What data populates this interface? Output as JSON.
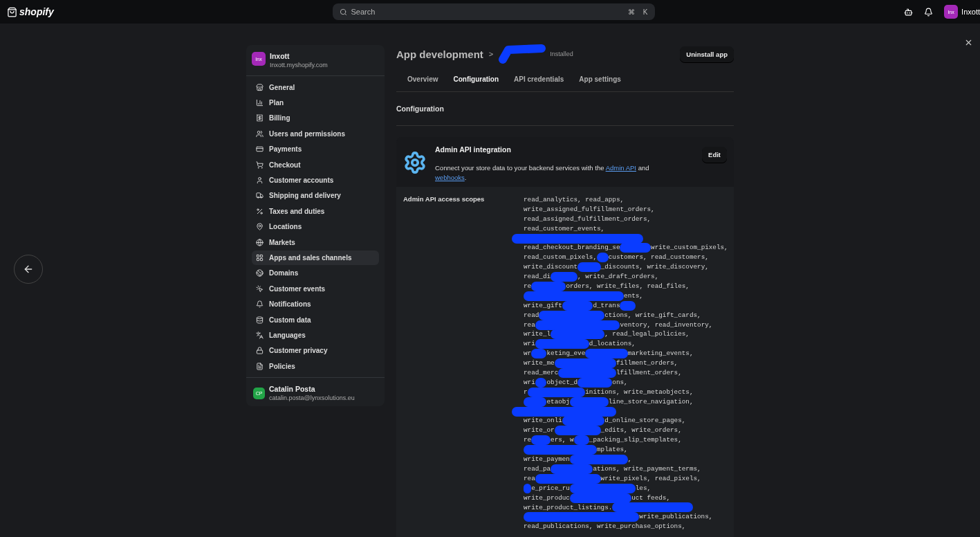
{
  "top_bar": {
    "logo": "shopify",
    "search": {
      "placeholder": "Search",
      "shortcut": [
        "⌘",
        "K"
      ]
    },
    "store_badge": "Inx",
    "store_name": "Inxott"
  },
  "sidebar": {
    "store": {
      "badge": "Inx",
      "name": "Inxott",
      "domain": "Inxott.myshopify.com"
    },
    "items": [
      {
        "label": "General",
        "selected": false
      },
      {
        "label": "Plan",
        "selected": false
      },
      {
        "label": "Billing",
        "selected": false
      },
      {
        "label": "Users and permissions",
        "selected": false
      },
      {
        "label": "Payments",
        "selected": false
      },
      {
        "label": "Checkout",
        "selected": false
      },
      {
        "label": "Customer accounts",
        "selected": false
      },
      {
        "label": "Shipping and delivery",
        "selected": false
      },
      {
        "label": "Taxes and duties",
        "selected": false
      },
      {
        "label": "Locations",
        "selected": false
      },
      {
        "label": "Markets",
        "selected": false
      },
      {
        "label": "Apps and sales channels",
        "selected": true
      },
      {
        "label": "Domains",
        "selected": false
      },
      {
        "label": "Customer events",
        "selected": false
      },
      {
        "label": "Notifications",
        "selected": false
      },
      {
        "label": "Custom data",
        "selected": false
      },
      {
        "label": "Languages",
        "selected": false
      },
      {
        "label": "Customer privacy",
        "selected": false
      },
      {
        "label": "Policies",
        "selected": false
      }
    ],
    "user": {
      "badge": "CP",
      "name": "Catalin Posta",
      "email": "catalin.posta@lynxsolutions.eu"
    }
  },
  "header": {
    "breadcrumb": "App development",
    "separator": ">",
    "status": "Installed",
    "action": "Uninstall app"
  },
  "tabs": [
    {
      "label": "Overview",
      "selected": false
    },
    {
      "label": "Configuration",
      "selected": true
    },
    {
      "label": "API credentials",
      "selected": false
    },
    {
      "label": "App settings",
      "selected": false
    }
  ],
  "section_title": "Configuration",
  "card": {
    "title": "Admin API integration",
    "description_start": "Connect your store data to your backend services with the",
    "link_1": "Admin API",
    "joiner": "and",
    "link_2": "webhooks",
    "end": ".",
    "edit": "Edit",
    "scopes_label": "Admin API access scopes",
    "scope_lines": [
      {
        "parts": [
          "read_analytics, read_apps,"
        ]
      },
      {
        "parts": [
          "write_assigned_fulfillment_orders,"
        ]
      },
      {
        "parts": [
          "read_assigned_fulfillment_orders,"
        ]
      },
      {
        "parts": [
          "read_customer_events,"
        ]
      },
      {
        "parts": [
          "read_checkout_branding_se",
          "write_custom_pixels,"
        ]
      },
      {
        "parts": [
          "read_custom_pixels,",
          "customers, read_customers,"
        ]
      },
      {
        "parts": [
          "write_discount",
          "_discounts, write_discovery,"
        ]
      },
      {
        "parts": [
          "read_di",
          ", write_draft_orders,"
        ]
      },
      {
        "parts": [
          "re",
          "orders, write_files, read_files,"
        ]
      },
      {
        "parts": [
          "ents,"
        ]
      },
      {
        "parts": [
          "write_gift",
          "d_trans"
        ]
      },
      {
        "parts": [
          "read",
          "ctions, write_gift_cards,"
        ]
      },
      {
        "parts": [
          "rea",
          "ventory, read_inventory,"
        ]
      },
      {
        "parts": [
          "write_l",
          ", read_legal_policies,"
        ]
      },
      {
        "parts": [
          "wri",
          "d_locations,"
        ]
      },
      {
        "parts": [
          "wr",
          "keting_eve",
          "marketing_events,"
        ]
      },
      {
        "parts": [
          "write_me",
          "fillment_orders,"
        ]
      },
      {
        "parts": [
          "read_merc",
          "lfillment_orders,"
        ]
      },
      {
        "parts": [
          "wri",
          "object_d",
          "ons,"
        ]
      },
      {
        "parts": [
          "r",
          "initions, write_metaobjects,"
        ]
      },
      {
        "parts": [
          "etaobj",
          "line_store_navigation,"
        ]
      },
      {
        "parts": [
          "write_onli",
          "d_online_store_pages,"
        ]
      },
      {
        "parts": [
          "write_or",
          "_edits, write_orders,"
        ]
      },
      {
        "parts": [
          "re",
          "ers, w",
          "_packing_slip_templates,"
        ]
      },
      {
        "parts": [
          "mplates,"
        ]
      },
      {
        "parts": [
          "write_paymen",
          ","
        ]
      },
      {
        "parts": [
          "read_pa",
          "ations, write_payment_terms,"
        ]
      },
      {
        "parts": [
          "rea",
          "write_pixels, read_pixels,"
        ]
      },
      {
        "parts": [
          "e_price_ru",
          "les,"
        ]
      },
      {
        "parts": [
          "write_produc",
          "uct feeds,"
        ]
      },
      {
        "parts": [
          "write_product_listings."
        ]
      },
      {
        "parts": [
          "write_publications,"
        ]
      },
      {
        "parts": [
          "read_publications, write_purchase_options,"
        ]
      }
    ]
  }
}
